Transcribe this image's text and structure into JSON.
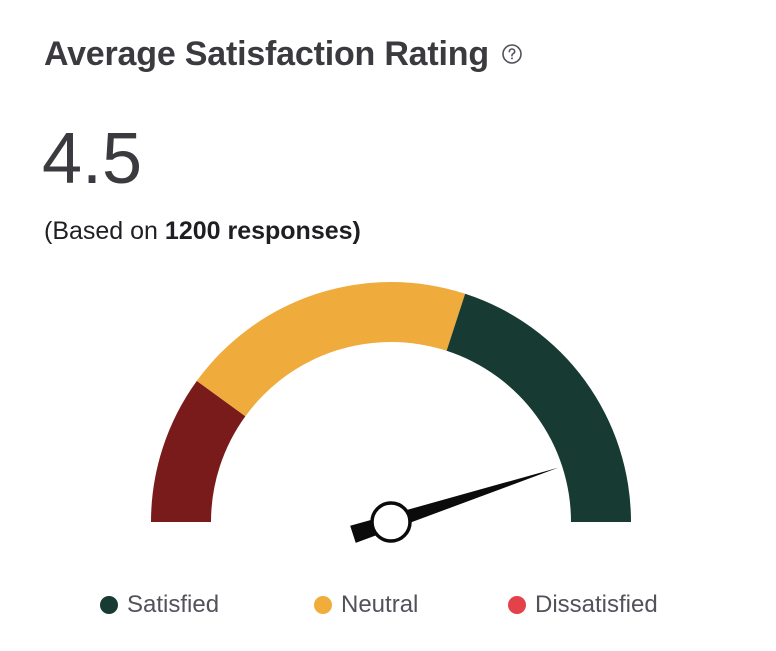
{
  "header": {
    "title": "Average Satisfaction Rating",
    "help_icon": "question-circle-icon"
  },
  "summary": {
    "value": "4.5",
    "based_prefix": "(Based on ",
    "based_count": "1200 responses)",
    "based_suffix": ""
  },
  "legend": {
    "items": [
      {
        "label": "Satisfied",
        "color": "#173a33"
      },
      {
        "label": "Neutral",
        "color": "#f0ad3c"
      },
      {
        "label": "Dissatisfied",
        "color": "#e4424a"
      }
    ]
  },
  "colors": {
    "dissatisfied_arc": "#7a1b1b",
    "neutral_arc": "#efab3c",
    "satisfied_arc": "#173a33",
    "needle": "#0b0b0b"
  },
  "chart_data": {
    "type": "gauge",
    "value": 4.5,
    "range": [
      0,
      5
    ],
    "segments": [
      {
        "name": "Dissatisfied",
        "from": 0,
        "to": 1
      },
      {
        "name": "Neutral",
        "from": 1,
        "to": 3
      },
      {
        "name": "Satisfied",
        "from": 3,
        "to": 5
      }
    ]
  }
}
